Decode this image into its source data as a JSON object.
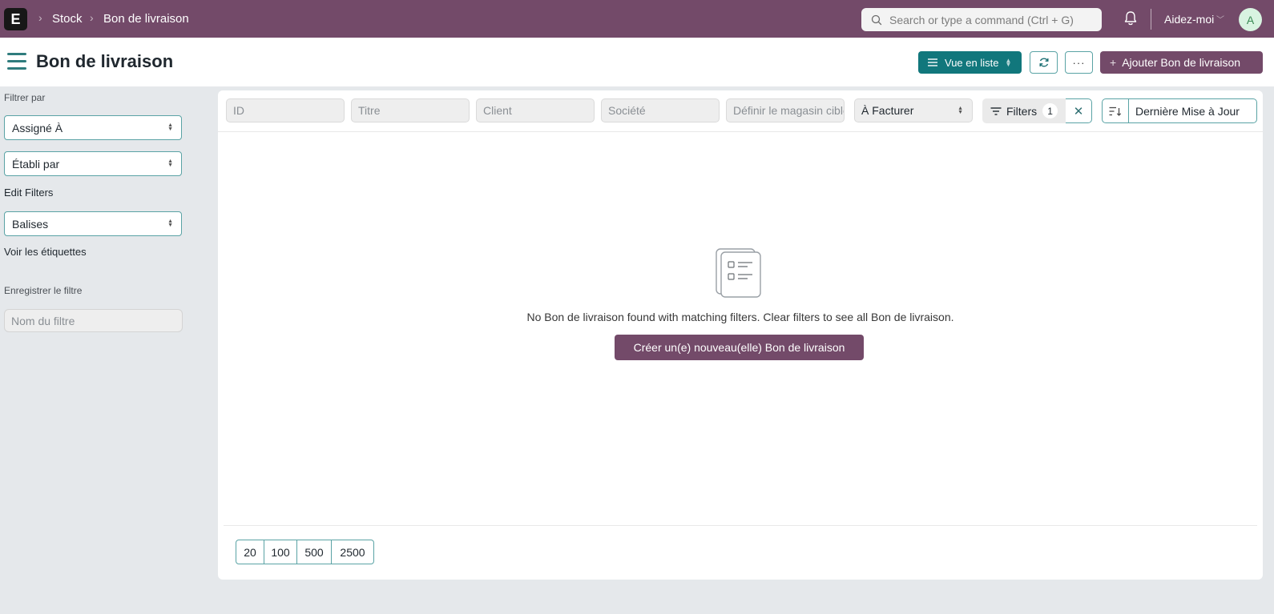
{
  "navbar": {
    "logo_letter": "E",
    "breadcrumbs": [
      "Stock",
      "Bon de livraison"
    ],
    "search_placeholder": "Search or type a command (Ctrl + G)",
    "help_label": "Aidez-moi",
    "avatar_initial": "A",
    "color": "#734a69"
  },
  "page_head": {
    "title": "Bon de livraison",
    "view_button_label": "Vue en liste",
    "add_button_label": "Ajouter Bon de livraison",
    "more_label": "···"
  },
  "sidebar": {
    "filter_by_label": "Filtrer par",
    "assigned_to": "Assigné À",
    "created_by": "Établi par",
    "edit_filters": "Edit Filters",
    "tags": "Balises",
    "show_tags": "Voir les étiquettes",
    "save_filter_label": "Enregistrer le filtre",
    "filter_name_placeholder": "Nom du filtre"
  },
  "filter_bar": {
    "id_placeholder": "ID",
    "title_placeholder": "Titre",
    "customer_placeholder": "Client",
    "company_placeholder": "Société",
    "warehouse_placeholder": "Définir le magasin cible",
    "status_value": "À Facturer",
    "filters_label": "Filters",
    "filters_count": "1",
    "sort_label": "Dernière Mise à Jour"
  },
  "empty_state": {
    "message": "No Bon de livraison found with matching filters. Clear filters to see all Bon de livraison.",
    "create_label": "Créer un(e) nouveau(elle) Bon de livraison"
  },
  "paging": [
    "20",
    "100",
    "500",
    "2500"
  ],
  "colors": {
    "primary": "#734a69",
    "accent": "#11777c",
    "background": "#e5e8eb"
  }
}
